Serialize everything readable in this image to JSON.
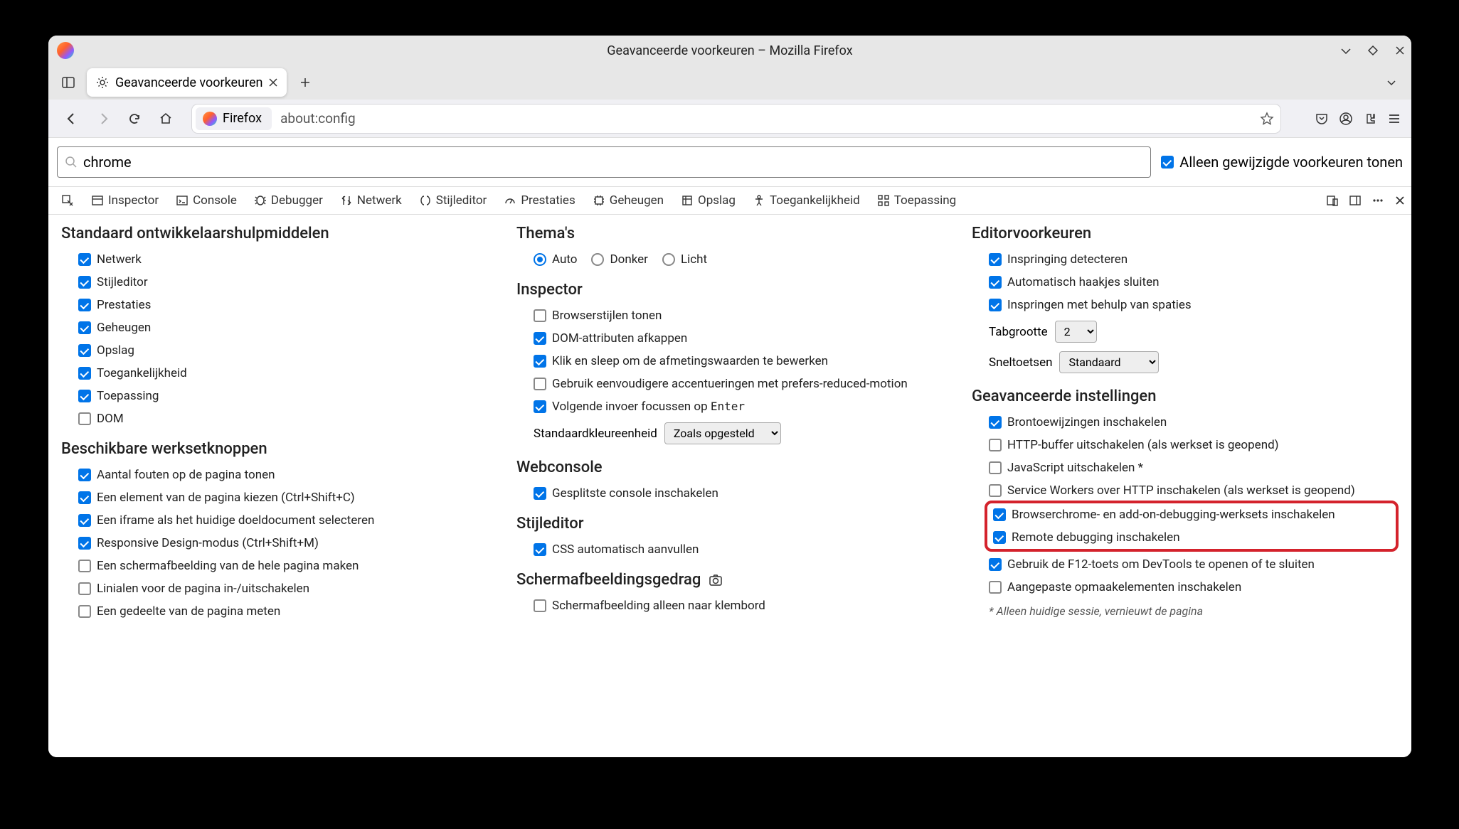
{
  "window": {
    "title": "Geavanceerde voorkeuren – Mozilla Firefox"
  },
  "tab": {
    "label": "Geavanceerde voorkeuren"
  },
  "urlbar": {
    "identity": "Firefox",
    "url": "about:config"
  },
  "search": {
    "value": "chrome",
    "modified_only_label": "Alleen gewijzigde voorkeuren tonen"
  },
  "devtools": {
    "inspector": "Inspector",
    "console": "Console",
    "debugger": "Debugger",
    "network": "Netwerk",
    "style": "Stijleditor",
    "perf": "Prestaties",
    "memory": "Geheugen",
    "storage": "Opslag",
    "a11y": "Toegankelijkheid",
    "app": "Toepassing"
  },
  "col1": {
    "section1_title": "Standaard ontwikkelaarshulpmiddelen",
    "items1": [
      "Netwerk",
      "Stijleditor",
      "Prestaties",
      "Geheugen",
      "Opslag",
      "Toegankelijkheid",
      "Toepassing",
      "DOM"
    ],
    "checked1": [
      true,
      true,
      true,
      true,
      true,
      true,
      true,
      false
    ],
    "section2_title": "Beschikbare werksetknoppen",
    "items2": [
      "Aantal fouten op de pagina tonen",
      "Een element van de pagina kiezen (Ctrl+Shift+C)",
      "Een iframe als het huidige doeldocument selecteren",
      "Responsive Design-modus (Ctrl+Shift+M)",
      "Een schermafbeelding van de hele pagina maken",
      "Linialen voor de pagina in-/uitschakelen",
      "Een gedeelte van de pagina meten"
    ],
    "checked2": [
      true,
      true,
      true,
      true,
      false,
      false,
      false
    ]
  },
  "col2": {
    "themes_title": "Thema's",
    "theme_auto": "Auto",
    "theme_dark": "Donker",
    "theme_light": "Licht",
    "inspector_title": "Inspector",
    "inspector_items": [
      "Browserstijlen tonen",
      "DOM-attributen afkappen",
      "Klik en sleep om de afmetingswaarden te bewerken",
      "Gebruik eenvoudigere accentueringen met prefers-reduced-motion"
    ],
    "inspector_checked": [
      false,
      true,
      true,
      false
    ],
    "focus_next_label_pre": "Volgende invoer focussen op ",
    "focus_next_label_key": "Enter",
    "color_unit_label": "Standaardkleureenheid",
    "color_unit_value": "Zoals opgesteld",
    "webconsole_title": "Webconsole",
    "webconsole_item": "Gesplitste console inschakelen",
    "style_title": "Stijleditor",
    "style_item": "CSS automatisch aanvullen",
    "screenshot_title": "Schermafbeeldingsgedrag",
    "screenshot_item": "Schermafbeelding alleen naar klembord"
  },
  "col3": {
    "editor_title": "Editorvoorkeuren",
    "editor_items": [
      "Inspringing detecteren",
      "Automatisch haakjes sluiten",
      "Inspringen met behulp van spaties"
    ],
    "editor_checked": [
      true,
      true,
      true
    ],
    "tabsize_label": "Tabgrootte",
    "tabsize_value": "2",
    "shortcuts_label": "Sneltoetsen",
    "shortcuts_value": "Standaard",
    "adv_title": "Geavanceerde instellingen",
    "adv_items": [
      "Brontoewijzingen inschakelen",
      "HTTP-buffer uitschakelen (als werkset is geopend)",
      "JavaScript uitschakelen *",
      "Service Workers over HTTP inschakelen (als werkset is geopend)"
    ],
    "adv_checked": [
      true,
      false,
      false,
      false
    ],
    "highlight_items": [
      "Browserchrome- en add-on-debugging-werksets inschakelen",
      "Remote debugging inschakelen"
    ],
    "highlight_checked": [
      true,
      true
    ],
    "adv_items_after": [
      "Gebruik de F12-toets om DevTools te openen of te sluiten",
      "Aangepaste opmaakelementen inschakelen"
    ],
    "adv_checked_after": [
      true,
      false
    ],
    "footnote": "* Alleen huidige sessie, vernieuwt de pagina"
  }
}
